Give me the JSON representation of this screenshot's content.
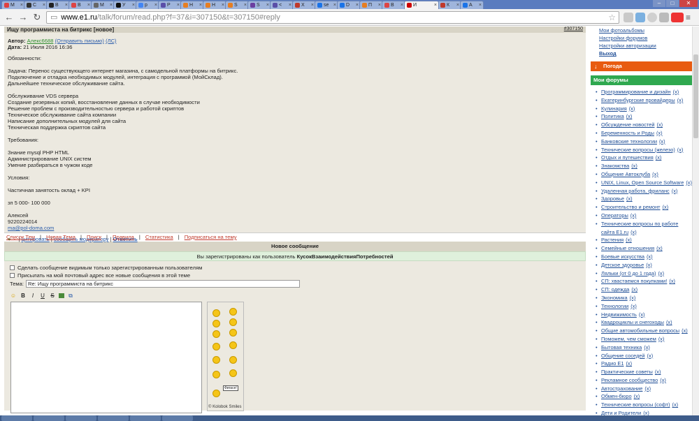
{
  "browser": {
    "tabs": [
      {
        "label": "M",
        "color": "#e04040"
      },
      {
        "label": "C",
        "color": "#333"
      },
      {
        "label": "В",
        "color": "#222"
      },
      {
        "label": "В",
        "color": "#d44"
      },
      {
        "label": "M",
        "color": "#666"
      },
      {
        "label": "У",
        "color": "#111"
      },
      {
        "label": "p",
        "color": "#4285f4"
      },
      {
        "label": "Р",
        "color": "#5a4ea8"
      },
      {
        "label": "Н",
        "color": "#e67e22"
      },
      {
        "label": "Н",
        "color": "#e67e22"
      },
      {
        "label": "S",
        "color": "#e67e22"
      },
      {
        "label": "S",
        "color": "#6b3fa0"
      },
      {
        "label": "<",
        "color": "#5a4ea8"
      },
      {
        "label": "Х",
        "color": "#c0392b"
      },
      {
        "label": "se",
        "color": "#1a73e8"
      },
      {
        "label": "D",
        "color": "#1a73e8"
      },
      {
        "label": "П",
        "color": "#e67e22"
      },
      {
        "label": "В",
        "color": "#d44"
      },
      {
        "label": "И",
        "color": "#c00",
        "active": true
      },
      {
        "label": "К",
        "color": "#c0392b"
      },
      {
        "label": "A",
        "color": "#1a73e8"
      }
    ],
    "url_host": "www.e1.ru",
    "url_path": "/talk/forum/read.php?f=37&i=307150&t=307150#reply"
  },
  "post": {
    "title": "Ищу программиста на битрикс",
    "new_badge": "[новое]",
    "number": "#307150",
    "author_label": "Автор:",
    "author": "Алекс6688",
    "send_mail": "(Отправить письмо)",
    "pm": "(ЛС)",
    "date_label": "Дата:",
    "date": "21 Июля 2016 16:36",
    "body": "Обязанности:\n\nЗадача: Перенос существующего интернет магазина, с самодельной платформы на битрикс.\nПодключение и отладка необходимых модулей, интеграция с программой (МойСклад).\nДальнейшее техническое обслуживание сайта.\n\nОбслуживание VDS сервера\nСоздание резервных копий, восстановление данных в случае необходимости\nРешение проблем с производительностью сервера и работой скриптов\nТехническое обслуживание сайта компании\nНаписание дополнительных модулей для сайта\nТехническая поддержка скриптов сайта\n\nТребования:\n\nЗнание mysql PHP HTML\nАдминистрирование UNIX систем\nУмение разбираться в чужом коде\n\nУсловия:\n\nЧастичная занятость оклад + KPI\n\nзп 5 000- 100 000\n\nАлексей\n9220224014",
    "email": "ma@pol-doma.com",
    "plus": "+",
    "minus": "-",
    "quote": "цитировать",
    "report": "сообщить модератору",
    "reply": "Ответить"
  },
  "nav_links": [
    "Список Тем",
    "Новая Тема",
    "Поиск",
    "Правила",
    "Статистика",
    "Подписаться на тему"
  ],
  "new_message": {
    "title": "Новое сообщение",
    "registered_prefix": "Вы зарегистрированы как пользователь ",
    "username": "КусокВзаимодействияПотребностей",
    "check_registered": "Сделать сообщение видимым только зарегистрированным пользователям",
    "check_mail": "Присылать на мой почтовый адрес все новые сообщения в этой теме",
    "theme_label": "Тема:",
    "theme_value": "Re: Ищу программиста на битрикс",
    "smiles_caption": "© Kolobok Smiles",
    "smile_sign": "Фигасе!"
  },
  "sidebar": {
    "top_links": [
      "Мои фотоальбомы",
      "Настройки форумов",
      "Настройки авторизации",
      "Выход"
    ],
    "weather": "Погода",
    "my_forums": "Мои форумы",
    "forums": [
      "Программирование и дизайн",
      "Екатеринбургские провайдеры",
      "Кулинария",
      "Политика",
      "Обсуждение новостей",
      "Беременность и Роды",
      "Банковские технологии",
      "Технические вопросы (железо)",
      "Отдых и путешествия",
      "Знакомства",
      "Общение Автоклуба",
      "UNIX, Linux, Open Source Software",
      "Удаленная работа, фриланс",
      "Здоровье",
      "Строительство и ремонт",
      "Операторы",
      "Технические вопросы по работе сайта E1.ru",
      "Растения",
      "Семейные отношения",
      "Боевые искусства",
      "Детское здоровье",
      "Ляльки (от 0 до 1 года)",
      "СП: хвастаемся покупками!",
      "СП: одежда",
      "Экономика",
      "Технологии",
      "Недвижимость",
      "Квадроциклы и снегоходы",
      "Общие автомобильные вопросы",
      "Поможем, чем сможем",
      "Бытовая техника",
      "Общение соседей",
      "Радио E1",
      "Практические советы",
      "Рекламное сообщество",
      "Автострахование",
      "Обмен-бюро",
      "Технические вопросы (софт)",
      "Дети и Родители"
    ],
    "remove": "(x)"
  }
}
